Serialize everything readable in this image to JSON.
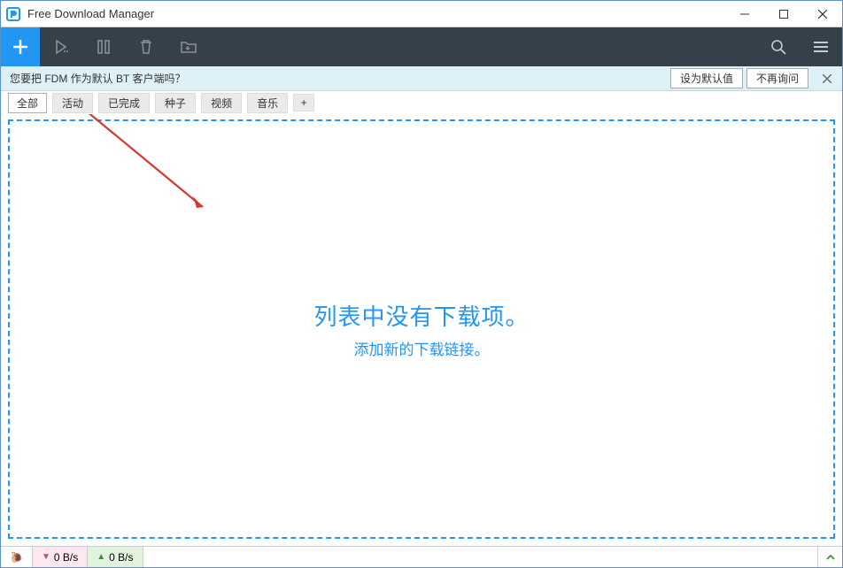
{
  "app_title": "Free Download Manager",
  "infobar": {
    "message": "您要把 FDM 作为默认 BT 客户端吗？",
    "set_default": "设为默认值",
    "dont_ask": "不再询问"
  },
  "filters": {
    "all": "全部",
    "active": "活动",
    "completed": "已完成",
    "seeds": "种子",
    "video": "视频",
    "music": "音乐",
    "add": "+"
  },
  "empty_state": {
    "title": "列表中没有下载项。",
    "subtitle": "添加新的下载链接。"
  },
  "status": {
    "down_speed": "0 B/s",
    "up_speed": "0 B/s"
  }
}
